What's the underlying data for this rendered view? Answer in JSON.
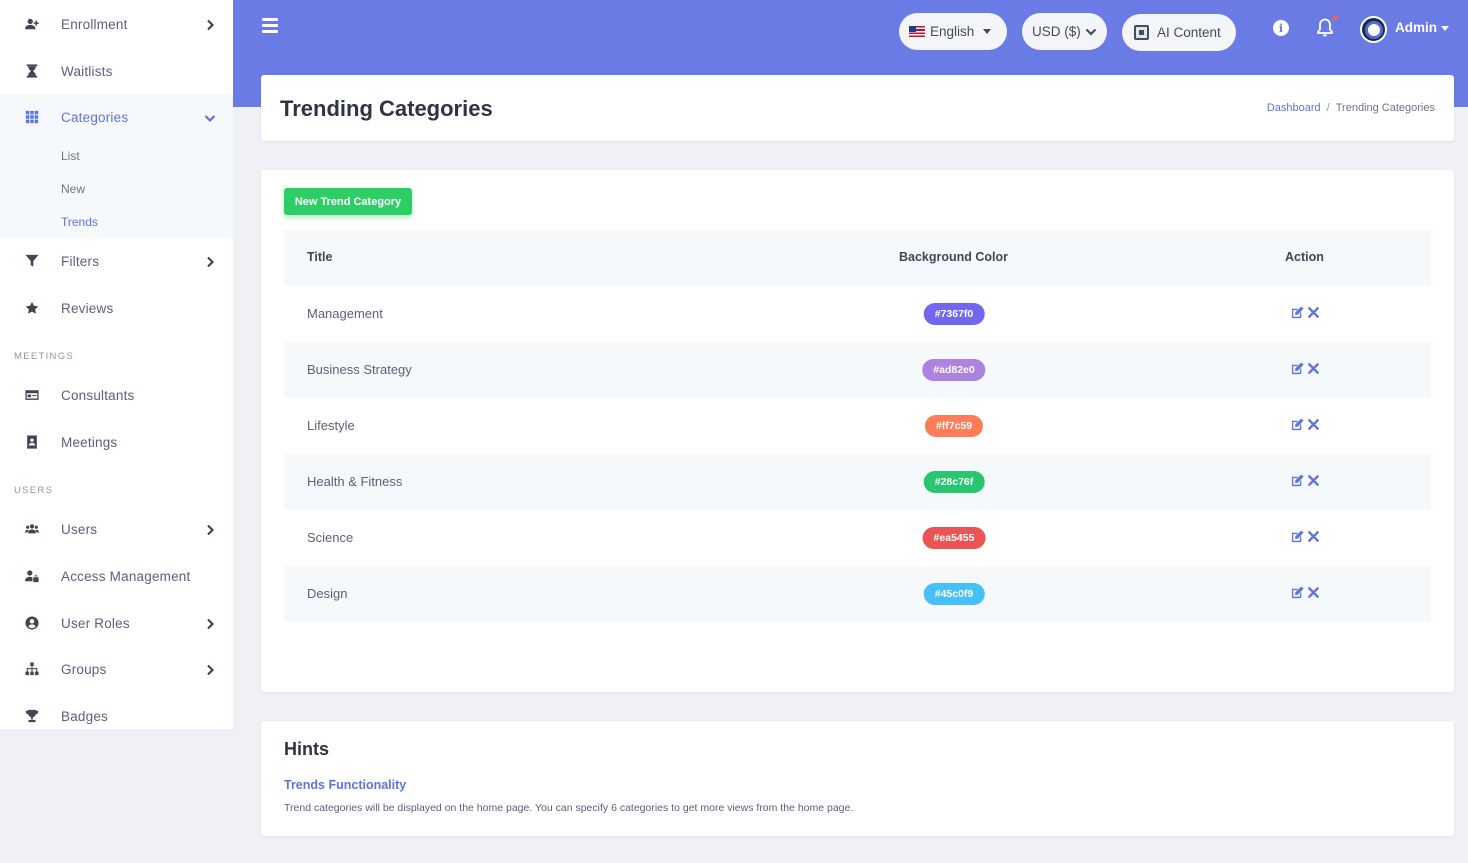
{
  "sidebar": {
    "items": [
      {
        "label": "Enrollment",
        "icon": "user-plus-icon"
      },
      {
        "label": "Waitlists",
        "icon": "hourglass-icon"
      },
      {
        "label": "Categories",
        "icon": "grid-icon"
      },
      {
        "label": "Filters",
        "icon": "filter-icon"
      },
      {
        "label": "Reviews",
        "icon": "star-icon"
      },
      {
        "label": "Consultants",
        "icon": "id-card-icon"
      },
      {
        "label": "Meetings",
        "icon": "address-book-icon"
      },
      {
        "label": "Users",
        "icon": "users-icon"
      },
      {
        "label": "Access Management",
        "icon": "user-lock-icon"
      },
      {
        "label": "User Roles",
        "icon": "user-circle-icon"
      },
      {
        "label": "Groups",
        "icon": "sitemap-icon"
      },
      {
        "label": "Badges",
        "icon": "trophy-icon"
      }
    ],
    "categories_sub": [
      "List",
      "New",
      "Trends"
    ],
    "sections": {
      "meetings": "MEETINGS",
      "users": "USERS"
    }
  },
  "topbar": {
    "language": "English",
    "currency": "USD ($)",
    "ai_content": "AI Content",
    "admin": "Admin"
  },
  "header": {
    "title": "Trending Categories",
    "breadcrumb": {
      "home": "Dashboard",
      "current": "Trending Categories"
    }
  },
  "main": {
    "new_button": "New Trend Category",
    "columns": [
      "Title",
      "Background Color",
      "Action"
    ],
    "rows": [
      {
        "title": "Management",
        "color": "#7367f0"
      },
      {
        "title": "Business Strategy",
        "color": "#ad82e0"
      },
      {
        "title": "Lifestyle",
        "color": "#ff7c59"
      },
      {
        "title": "Health & Fitness",
        "color": "#28c76f"
      },
      {
        "title": "Science",
        "color": "#ea5455"
      },
      {
        "title": "Design",
        "color": "#45c0f9"
      }
    ]
  },
  "hints": {
    "title": "Hints",
    "subtitle": "Trends Functionality",
    "text": "Trend categories will be displayed on the home page. You can specify 6 categories to get more views from the home page."
  },
  "colors": {
    "accent": "#5e72e4",
    "topbar": "#6b7be6",
    "success": "#2dce66"
  }
}
